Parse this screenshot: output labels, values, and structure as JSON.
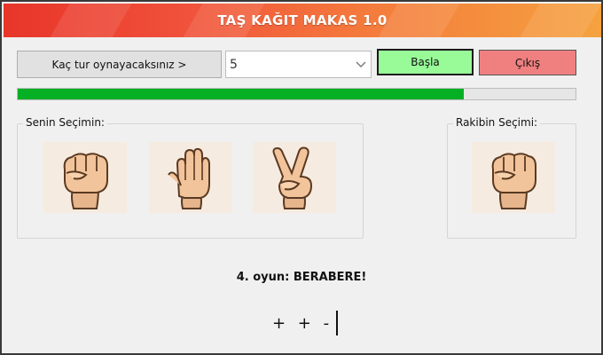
{
  "app": {
    "title": "TAŞ KAĞIT MAKAS 1.0"
  },
  "controls": {
    "rounds_label": "Kaç tur oynayacaksınız >",
    "rounds_value": "5",
    "start_label": "Başla",
    "exit_label": "Çıkış"
  },
  "progress": {
    "fraction": 0.8
  },
  "player": {
    "legend": "Senin Seçimin:",
    "choices": [
      {
        "name": "rock",
        "icon": "fist-icon"
      },
      {
        "name": "paper",
        "icon": "open-hand-icon"
      },
      {
        "name": "scissors",
        "icon": "victory-hand-icon"
      }
    ]
  },
  "rival": {
    "legend": "Rakibin Seçimi:",
    "choice_icon": "fist-icon"
  },
  "result": {
    "text": "4. oyun: BERABERE!"
  },
  "score": {
    "marks": "+ + -"
  },
  "colors": {
    "start": "#98fb98",
    "exit": "#f08080",
    "progress": "#06b025",
    "title_from": "#e8352a",
    "title_to": "#f5a23f"
  }
}
